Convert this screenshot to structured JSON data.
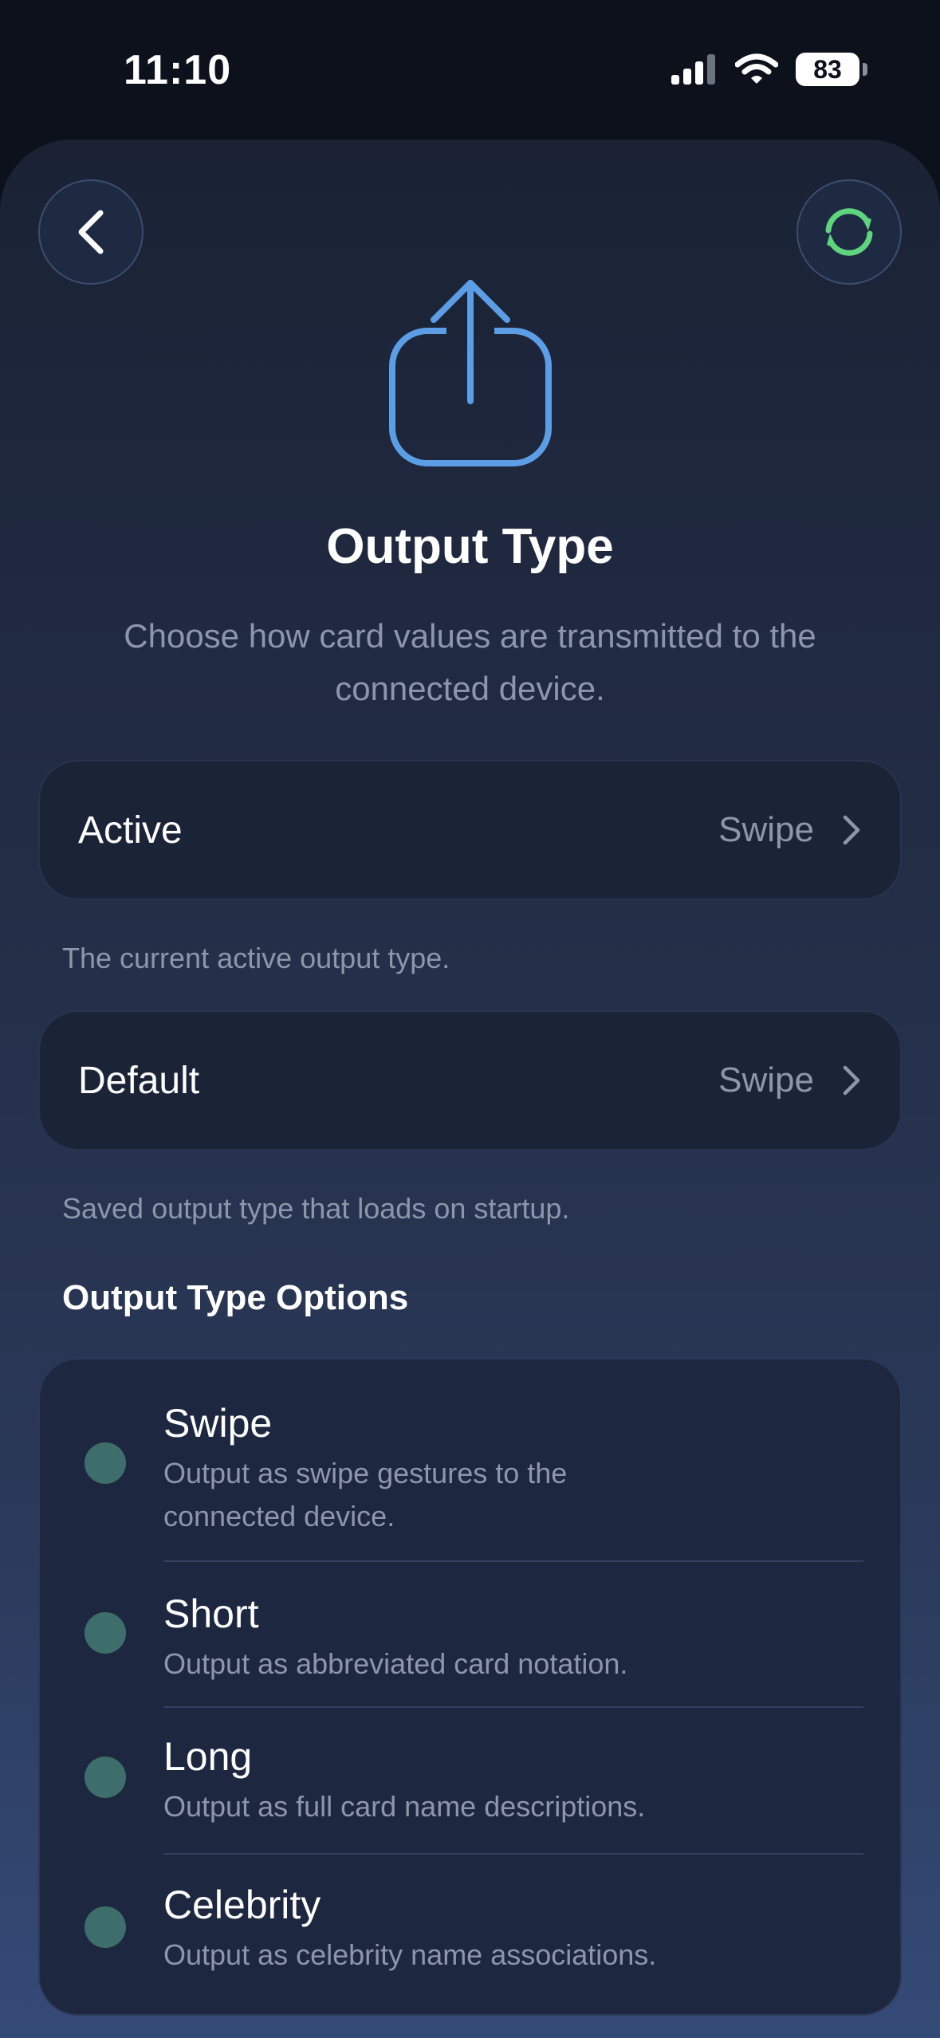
{
  "status_bar": {
    "time": "11:10",
    "battery_level": "83",
    "icons": [
      "cellular-signal-icon",
      "wifi-icon",
      "battery-icon"
    ]
  },
  "header": {
    "back_icon": "chevron-left-icon",
    "refresh_icon": "refresh-icon",
    "hero_icon": "share-upload-icon",
    "title": "Output Type",
    "subtitle": "Choose how card values are transmitted to the connected device."
  },
  "active": {
    "label": "Active",
    "value": "Swipe",
    "note": "The current active output type."
  },
  "default": {
    "label": "Default",
    "value": "Swipe",
    "note": "Saved output type that loads on startup."
  },
  "options_section": {
    "heading": "Output Type Options",
    "items": [
      {
        "name": "Swipe",
        "description": "Output as swipe gestures to the connected device."
      },
      {
        "name": "Short",
        "description": "Output as abbreviated card notation."
      },
      {
        "name": "Long",
        "description": "Output as full card name descriptions."
      },
      {
        "name": "Celebrity",
        "description": "Output as celebrity name associations."
      }
    ]
  },
  "colors": {
    "accent_blue": "#5b9ee6",
    "refresh_green": "#5fd47e",
    "option_dot": "#3d6e6b",
    "secondary_text": "#8d96aa"
  }
}
